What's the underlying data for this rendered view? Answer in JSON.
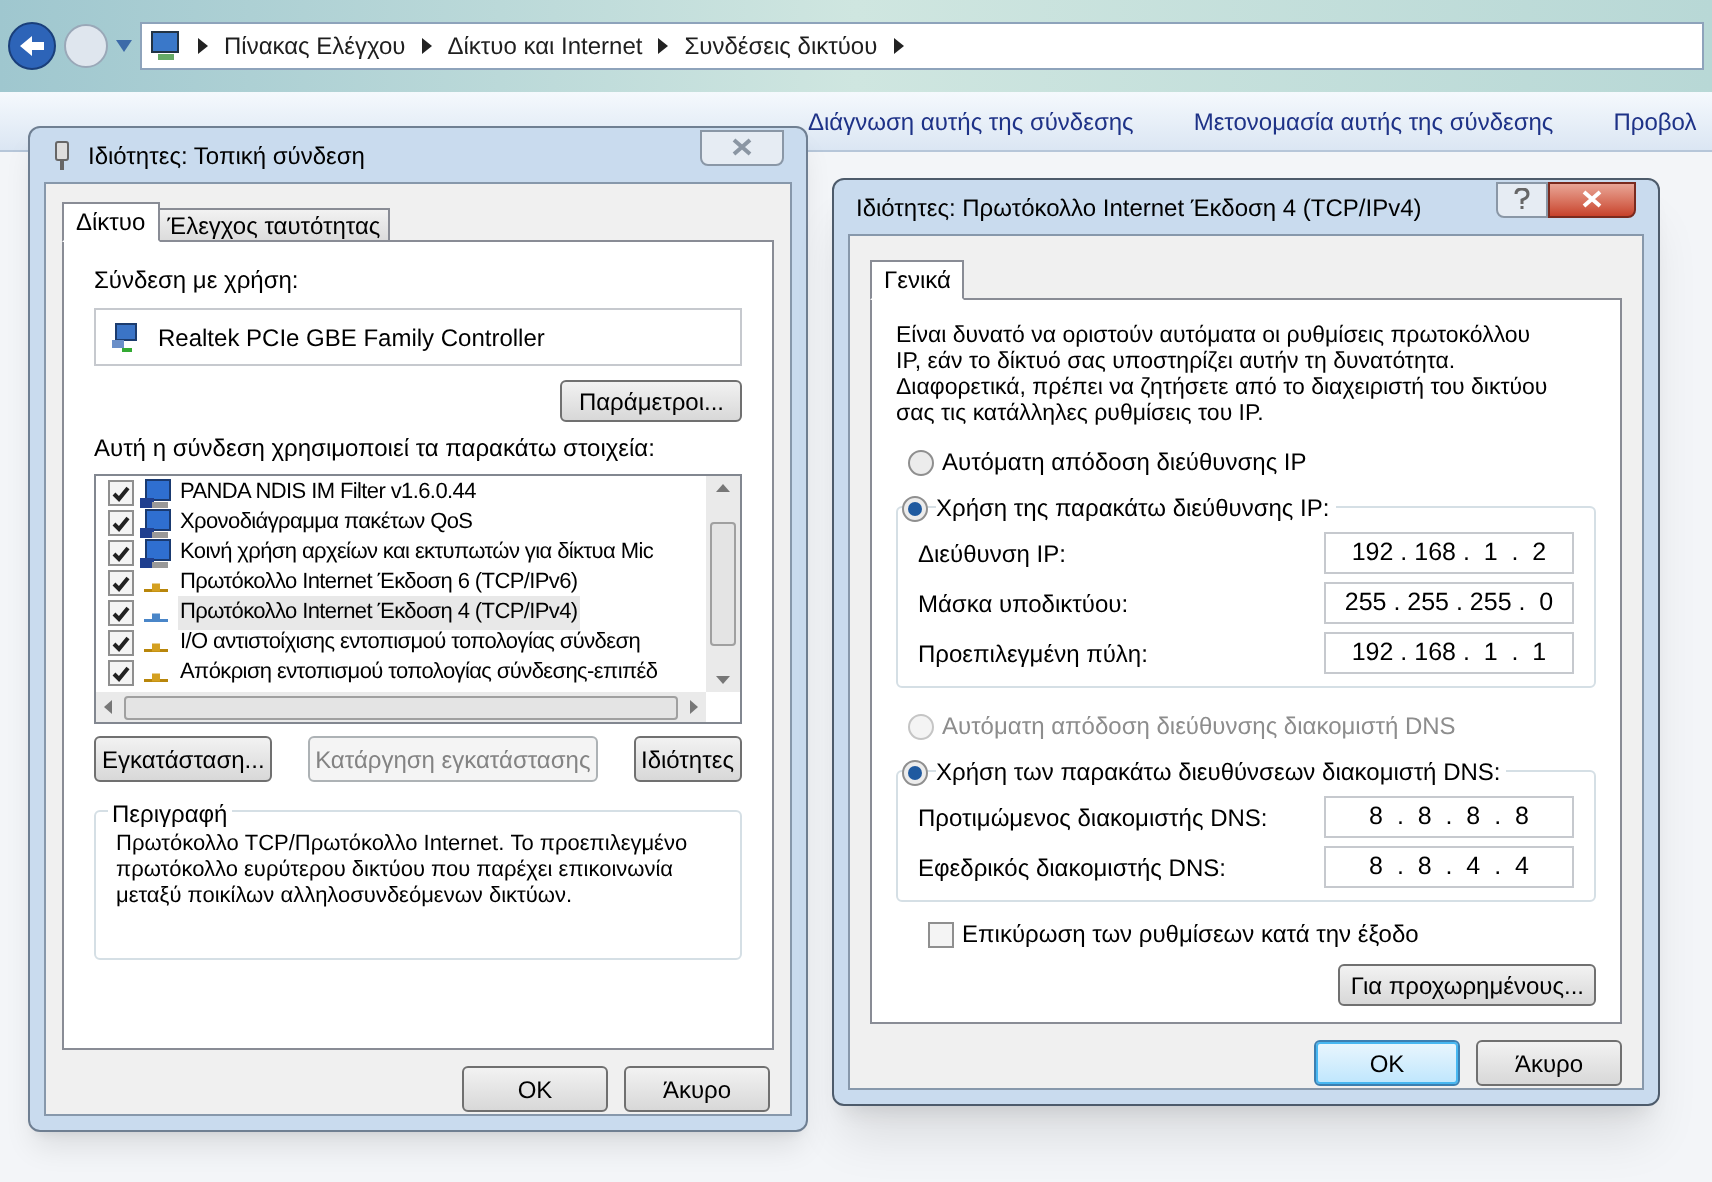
{
  "explorer": {
    "breadcrumb": [
      "Πίνακας Ελέγχου",
      "Δίκτυο και Internet",
      "Συνδέσεις δικτύου"
    ],
    "toolbar": [
      "Διάγνωση αυτής της σύνδεσης",
      "Μετονομασία αυτής της σύνδεσης",
      "Προβολ"
    ]
  },
  "connection_dialog": {
    "title": "Ιδιότητες: Τοπική σύνδεση",
    "tabs": [
      {
        "label": "Δίκτυο",
        "selected": true
      },
      {
        "label": "Έλεγχος ταυτότητας",
        "selected": false
      }
    ],
    "connect_using_label": "Σύνδεση με χρήση:",
    "adapter": "Realtek PCIe GBE Family Controller",
    "configure_button": "Παράμετροι...",
    "items_label": "Αυτή η σύνδεση χρησιμοποιεί τα παρακάτω στοιχεία:",
    "items": [
      {
        "label": "PANDA NDIS IM Filter v1.6.0.44",
        "checked": true,
        "selected": false,
        "kind": "client"
      },
      {
        "label": "Χρονοδιάγραμμα πακέτων QoS",
        "checked": true,
        "selected": false,
        "kind": "client"
      },
      {
        "label": "Κοινή χρήση αρχείων και εκτυπωτών για δίκτυα Mic",
        "checked": true,
        "selected": false,
        "kind": "client"
      },
      {
        "label": "Πρωτόκολλο Internet Έκδοση 6 (TCP/IPv6)",
        "checked": true,
        "selected": false,
        "kind": "protocol"
      },
      {
        "label": "Πρωτόκολλο Internet Έκδοση 4 (TCP/IPv4)",
        "checked": true,
        "selected": true,
        "kind": "protocol"
      },
      {
        "label": "Ι/Ο αντιστοίχισης εντοπισμού τοπολογίας σύνδεση",
        "checked": true,
        "selected": false,
        "kind": "protocol"
      },
      {
        "label": "Απόκριση εντοπισμού τοπολογίας σύνδεσης-επιπέδ",
        "checked": true,
        "selected": false,
        "kind": "protocol"
      }
    ],
    "buttons": [
      {
        "label": "Εγκατάσταση...",
        "disabled": false
      },
      {
        "label": "Κατάργηση εγκατάστασης",
        "disabled": true
      },
      {
        "label": "Ιδιότητες",
        "disabled": false
      }
    ],
    "description": {
      "legend": "Περιγραφή",
      "text": "Πρωτόκολλο TCP/Πρωτόκολλο Internet. Το προεπιλεγμένο πρωτόκολλο ευρύτερου δικτύου που παρέχει επικοινωνία μεταξύ ποικίλων αλληλοσυνδεόμενων δικτύων."
    },
    "footer_buttons": [
      {
        "label": "OK",
        "default": false
      },
      {
        "label": "Άκυρο",
        "default": false
      }
    ]
  },
  "ipv4_dialog": {
    "title": "Ιδιότητες: Πρωτόκολλο Internet Έκδοση 4 (TCP/IPv4)",
    "tabs": [
      {
        "label": "Γενικά",
        "selected": true
      }
    ],
    "intro": "Είναι δυνατό να οριστούν αυτόματα οι ρυθμίσεις πρωτοκόλλου IP, εάν το δίκτυό σας υποστηρίζει αυτήν τη δυνατότητα. Διαφορετικά, πρέπει να ζητήσετε από το διαχειριστή του δικτύου σας τις κατάλληλες ρυθμίσεις του IP.",
    "ip_options": [
      {
        "label": "Αυτόματη απόδοση διεύθυνσης IP",
        "selected": false,
        "disabled": false
      },
      {
        "label": "Χρήση της παρακάτω διεύθυνσης IP:",
        "selected": true,
        "disabled": false
      }
    ],
    "ip_fields": [
      {
        "label": "Διεύθυνση IP:",
        "value": "192 . 168 .  1  .  2"
      },
      {
        "label": "Μάσκα υποδικτύου:",
        "value": "255 . 255 . 255 .  0"
      },
      {
        "label": "Προεπιλεγμένη πύλη:",
        "value": "192 . 168 .  1  .  1"
      }
    ],
    "dns_options": [
      {
        "label": "Αυτόματη απόδοση διεύθυνσης διακομιστή DNS",
        "selected": false,
        "disabled": true
      },
      {
        "label": "Χρήση των παρακάτω διευθύνσεων διακομιστή DNS:",
        "selected": true,
        "disabled": false
      }
    ],
    "dns_fields": [
      {
        "label": "Προτιμώμενος διακομιστής DNS:",
        "value": "8  .  8  .  8  .  8"
      },
      {
        "label": "Εφεδρικός διακομιστής DNS:",
        "value": "8  .  8  .  4  .  4"
      }
    ],
    "validate": {
      "label": "Επικύρωση των ρυθμίσεων κατά την έξοδο",
      "checked": false
    },
    "advanced_button": "Για προχωρημένους...",
    "footer_buttons": [
      {
        "label": "OK",
        "default": true
      },
      {
        "label": "Άκυρο",
        "default": false
      }
    ]
  }
}
